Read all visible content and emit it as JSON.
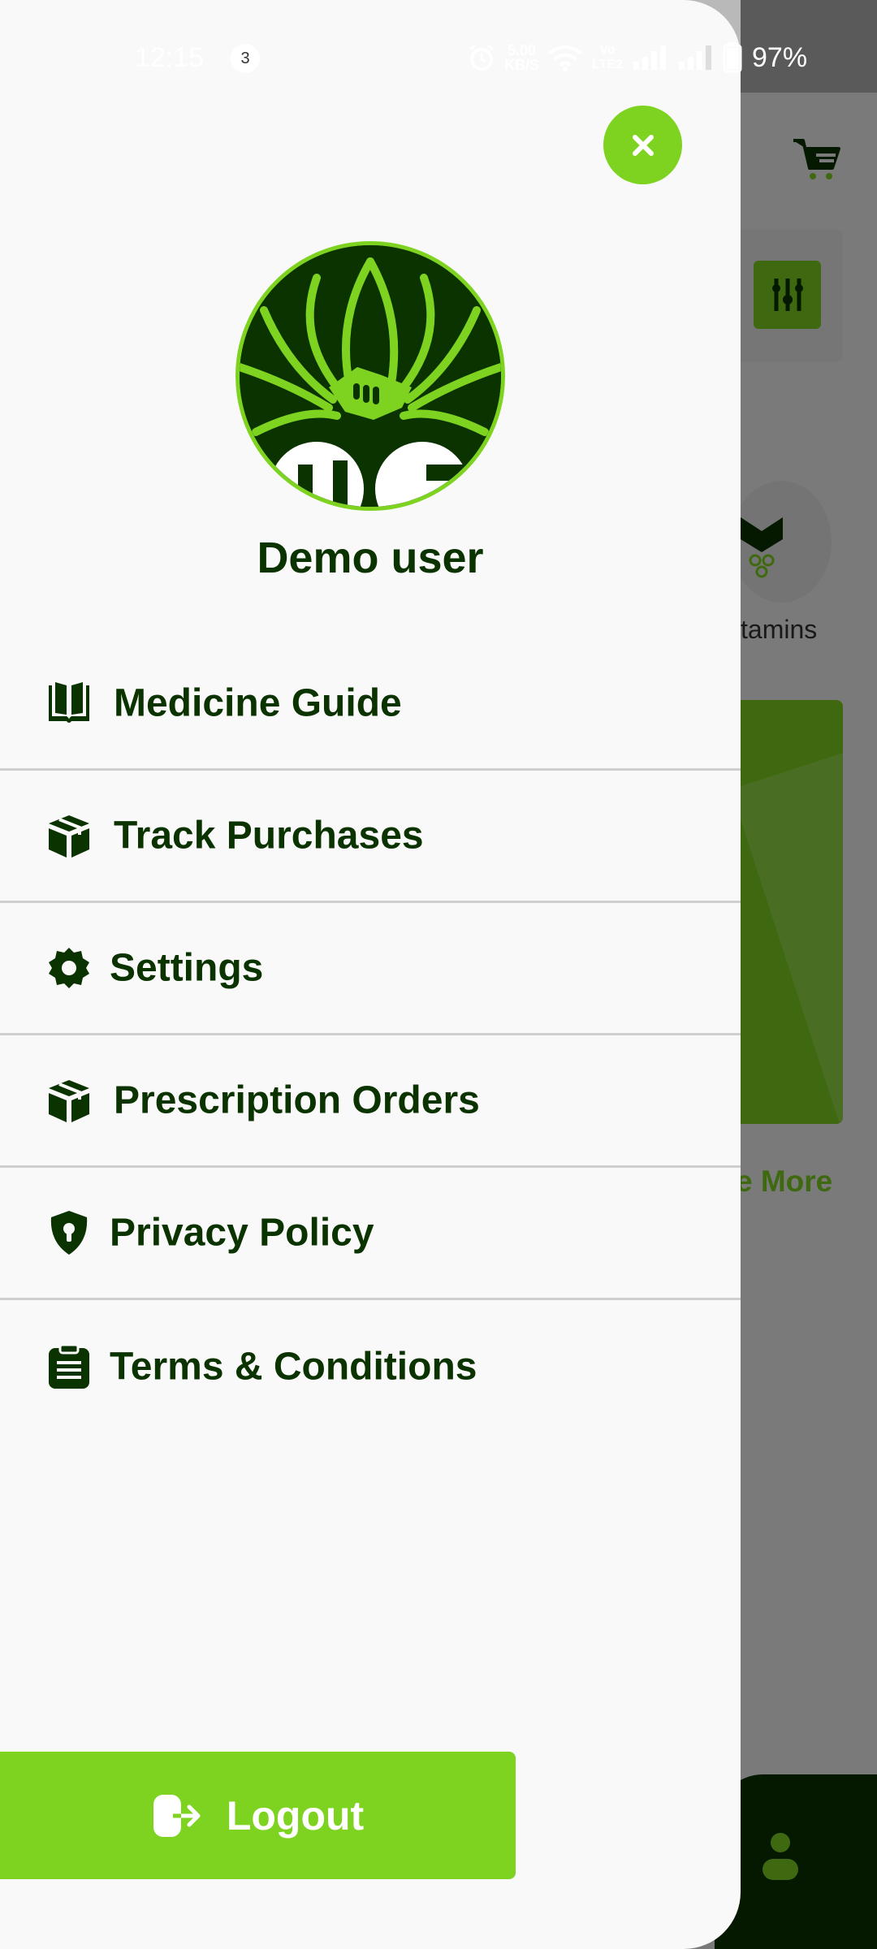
{
  "status_bar": {
    "time": "12:15",
    "notification_count": "3",
    "net_speed_value": "5.00",
    "net_speed_unit": "KB/S",
    "volte_label": "Vo LTE2",
    "battery_percent": "97%"
  },
  "background": {
    "category_label": "tamins",
    "see_more_label": "e More"
  },
  "drawer": {
    "user_name": "Demo user",
    "menu": [
      {
        "label": "Medicine Guide",
        "icon": "book-icon"
      },
      {
        "label": "Track Purchases",
        "icon": "box-icon"
      },
      {
        "label": "Settings",
        "icon": "gear-icon"
      },
      {
        "label": "Prescription Orders",
        "icon": "box-icon"
      },
      {
        "label": "Privacy Policy",
        "icon": "shield-lock-icon"
      },
      {
        "label": "Terms & Conditions",
        "icon": "clipboard-icon"
      }
    ],
    "logout_label": "Logout"
  },
  "colors": {
    "accent": "#7ed321",
    "dark_green": "#0b3300",
    "drawer_bg": "#f9f9f9",
    "divider": "#cfcfcf"
  }
}
